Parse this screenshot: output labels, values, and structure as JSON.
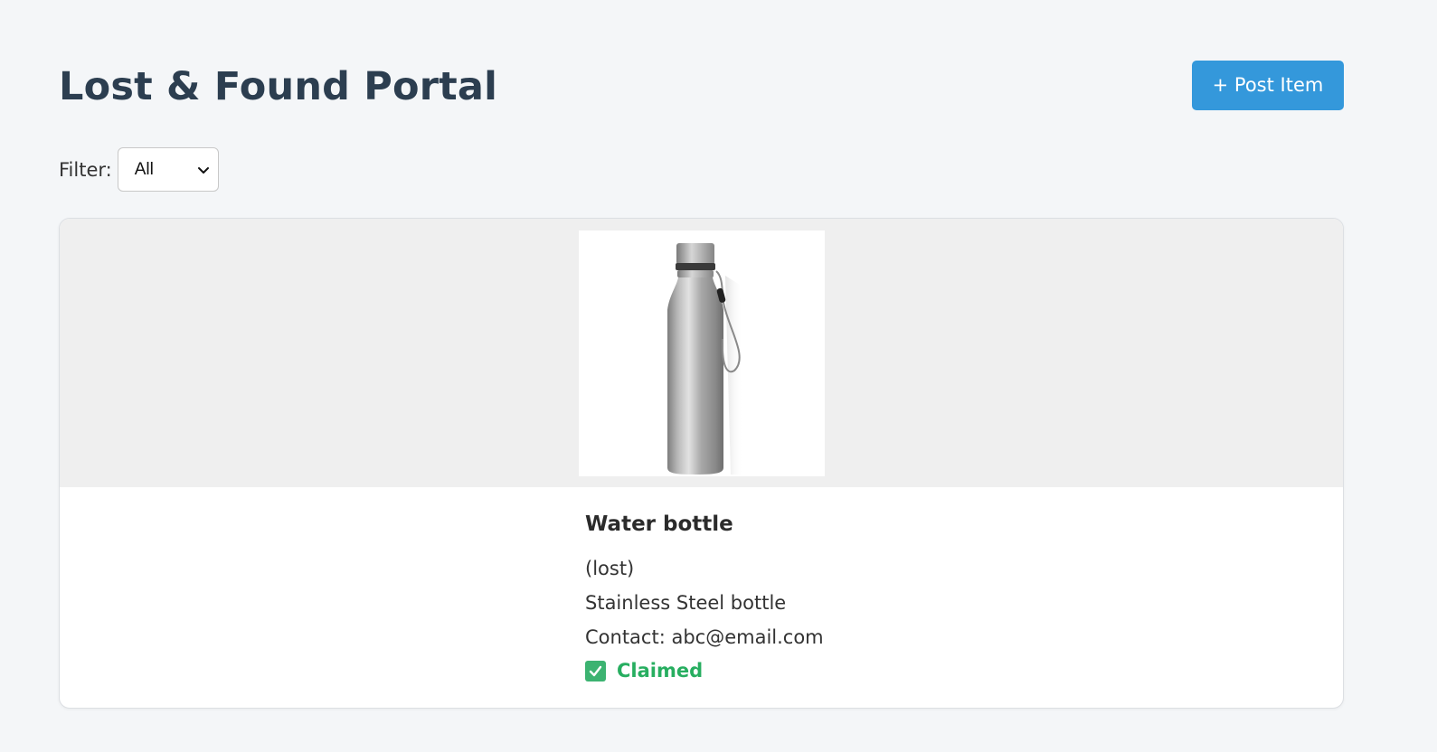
{
  "header": {
    "title": "Lost & Found Portal",
    "post_button_label": "+ Post Item"
  },
  "filter": {
    "label": "Filter:",
    "selected": "All",
    "icon": "chevron-down-icon"
  },
  "items": [
    {
      "title": "Water bottle",
      "type": "(lost)",
      "description": "Stainless Steel bottle",
      "contact": "Contact: abc@email.com",
      "status": "Claimed",
      "status_icon": "check-box-icon",
      "status_color": "#27ae60"
    }
  ],
  "colors": {
    "accent": "#3498db",
    "title": "#2c3e50",
    "success": "#27ae60"
  }
}
